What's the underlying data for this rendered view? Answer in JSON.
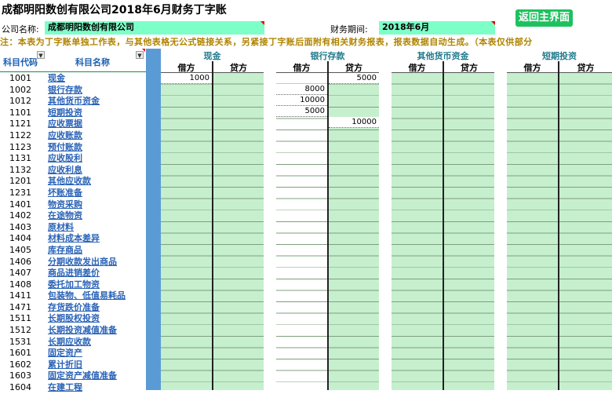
{
  "title": "成都明阳数创有限公司2018年6月财务丁字账",
  "back_button": "返回主界面",
  "company_label": "公司名称:",
  "company_value": "成都明阳数创有限公司",
  "period_label": "财务期间:",
  "period_value": "2018年6月",
  "notice": "注：本表为丁字账单独工作表，与其他表格无公式链接关系，另紧接丁字账后面附有相关财务报表，报表数据自动生成。（本表仅供部分",
  "col_code": "科目代码",
  "col_name": "科目名称",
  "groups": [
    {
      "title": "现金",
      "debit": "借方",
      "credit": "贷方"
    },
    {
      "title": "银行存款",
      "debit": "借方",
      "credit": "贷方"
    },
    {
      "title": "其他货币资金",
      "debit": "借方",
      "credit": "贷方"
    },
    {
      "title": "短期投资",
      "debit": "借方",
      "credit": "贷方"
    }
  ],
  "accounts": [
    {
      "code": "1001",
      "name": "现金"
    },
    {
      "code": "1002",
      "name": "银行存款"
    },
    {
      "code": "1012",
      "name": "其他货币资金"
    },
    {
      "code": "1101",
      "name": "短期投资"
    },
    {
      "code": "1121",
      "name": "应收票据"
    },
    {
      "code": "1122",
      "name": "应收账款"
    },
    {
      "code": "1123",
      "name": "预付账款"
    },
    {
      "code": "1131",
      "name": "应收股利"
    },
    {
      "code": "1132",
      "name": "应收利息"
    },
    {
      "code": "1201",
      "name": "其他应收款"
    },
    {
      "code": "1231",
      "name": "坏账准备"
    },
    {
      "code": "1401",
      "name": "物资采购"
    },
    {
      "code": "1402",
      "name": "在途物资"
    },
    {
      "code": "1403",
      "name": "原材料"
    },
    {
      "code": "1404",
      "name": "材料成本差异"
    },
    {
      "code": "1405",
      "name": "库存商品"
    },
    {
      "code": "1406",
      "name": "分期收款发出商品"
    },
    {
      "code": "1407",
      "name": "商品进销差价"
    },
    {
      "code": "1408",
      "name": "委托加工物资"
    },
    {
      "code": "1411",
      "name": "包装物、低值易耗品"
    },
    {
      "code": "1471",
      "name": "存货跌价准备"
    },
    {
      "code": "1511",
      "name": "长期股权投资"
    },
    {
      "code": "1512",
      "name": "长期投资减值准备"
    },
    {
      "code": "1531",
      "name": "长期应收款"
    },
    {
      "code": "1601",
      "name": "固定资产"
    },
    {
      "code": "1602",
      "name": "累计折旧"
    },
    {
      "code": "1603",
      "name": "固定资产减值准备"
    },
    {
      "code": "1604",
      "name": "在建工程"
    }
  ],
  "entries": {
    "cash_debit": [
      "1000"
    ],
    "cash_credit": [],
    "bank_debit": [
      "",
      "8000",
      "10000",
      "5000"
    ],
    "bank_credit": [
      "5000",
      "",
      "",
      "",
      "10000"
    ]
  }
}
